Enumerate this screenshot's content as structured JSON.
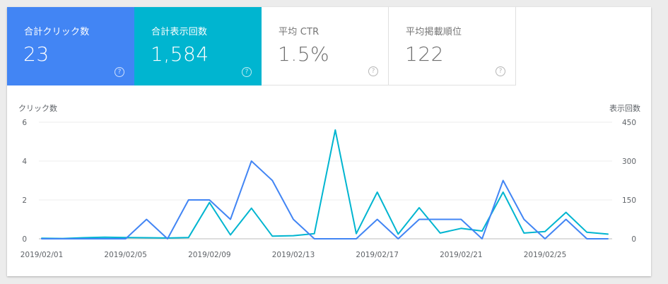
{
  "tiles": [
    {
      "label": "合計クリック数",
      "value": "23",
      "help": "?"
    },
    {
      "label": "合計表示回数",
      "value": "1,584",
      "help": "?"
    },
    {
      "label": "平均 CTR",
      "value": "1.5%",
      "help": "?"
    },
    {
      "label": "平均掲載順位",
      "value": "122",
      "help": "?"
    }
  ],
  "colors": {
    "clicks": "#4285f4",
    "impressions": "#00b5d0"
  },
  "chart_data": {
    "type": "line",
    "ylabel_left": "クリック数",
    "ylabel_right": "表示回数",
    "left_ticks": [
      "0",
      "2",
      "4",
      "6"
    ],
    "right_ticks": [
      "0",
      "150",
      "300",
      "450"
    ],
    "ylim_left": [
      0,
      6
    ],
    "ylim_right": [
      0,
      450
    ],
    "x_tick_labels": [
      "2019/02/01",
      "2019/02/05",
      "2019/02/09",
      "2019/02/13",
      "2019/02/17",
      "2019/02/21",
      "2019/02/25"
    ],
    "x": [
      "2019/02/01",
      "2019/02/02",
      "2019/02/03",
      "2019/02/04",
      "2019/02/05",
      "2019/02/06",
      "2019/02/07",
      "2019/02/08",
      "2019/02/09",
      "2019/02/10",
      "2019/02/11",
      "2019/02/12",
      "2019/02/13",
      "2019/02/14",
      "2019/02/15",
      "2019/02/16",
      "2019/02/17",
      "2019/02/18",
      "2019/02/19",
      "2019/02/20",
      "2019/02/21",
      "2019/02/22",
      "2019/02/23",
      "2019/02/24",
      "2019/02/25",
      "2019/02/26",
      "2019/02/27",
      "2019/02/28"
    ],
    "series": [
      {
        "name": "クリック数",
        "axis": "left",
        "values": [
          0,
          0,
          0,
          0,
          0,
          1,
          0,
          2,
          2,
          1,
          4,
          3,
          1,
          0,
          0,
          0,
          1,
          0,
          1,
          1,
          1,
          0,
          3,
          1,
          0,
          1,
          0,
          0
        ]
      },
      {
        "name": "表示回数",
        "axis": "right",
        "values": [
          2,
          1,
          4,
          6,
          5,
          4,
          3,
          5,
          140,
          15,
          118,
          10,
          12,
          20,
          420,
          20,
          180,
          18,
          120,
          22,
          40,
          30,
          180,
          22,
          28,
          102,
          25,
          18
        ]
      }
    ],
    "grid": true
  }
}
